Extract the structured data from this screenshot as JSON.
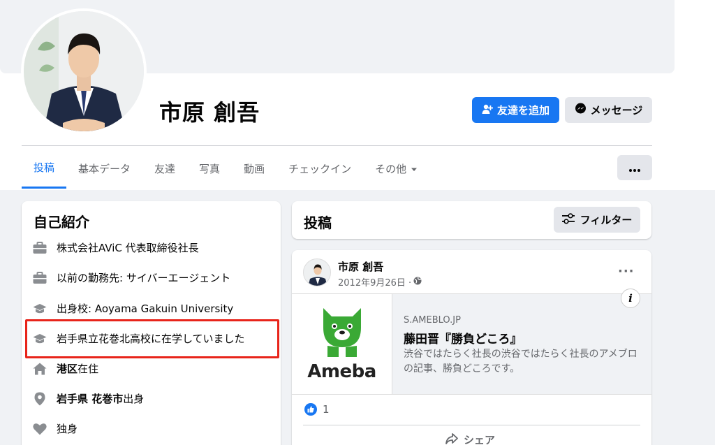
{
  "profile": {
    "name": "市原 創吾",
    "add_friend_label": "友達を追加",
    "message_label": "メッセージ"
  },
  "tabs": [
    {
      "label": "投稿",
      "active": true
    },
    {
      "label": "基本データ"
    },
    {
      "label": "友達"
    },
    {
      "label": "写真"
    },
    {
      "label": "動画"
    },
    {
      "label": "チェックイン"
    },
    {
      "label": "その他"
    }
  ],
  "intro": {
    "title": "自己紹介",
    "items": [
      {
        "icon": "briefcase-icon",
        "text": "株式会社AViC 代表取締役社長"
      },
      {
        "icon": "briefcase-icon",
        "text": "以前の勤務先: サイバーエージェント"
      },
      {
        "icon": "graduation-cap-icon",
        "text": "出身校: Aoyama Gakuin University"
      },
      {
        "icon": "graduation-cap-icon",
        "text": "岩手県立花巻北高校に在学していました"
      },
      {
        "icon": "home-icon",
        "bold": "港区",
        "text": "在住"
      },
      {
        "icon": "location-pin-icon",
        "bold": "岩手県 花巻市",
        "text": "出身"
      },
      {
        "icon": "heart-icon",
        "text": "独身"
      }
    ]
  },
  "posts": {
    "title": "投稿",
    "filter_label": "フィルター"
  },
  "post": {
    "author": "市原 創吾",
    "date": "2012年9月26日 ·",
    "link": {
      "logo_text": "Ameba",
      "domain": "S.AMEBLO.JP",
      "title": "藤田晋『勝負どころ』",
      "description": "渋谷ではたらく社長の渋谷ではたらく社長のアメブロの記事、勝負どころです。"
    },
    "like_count": "1",
    "share_label": "シェア"
  },
  "colors": {
    "accent": "#1877f2",
    "highlight": "#e8241a",
    "ameba_green": "#3aa935"
  }
}
